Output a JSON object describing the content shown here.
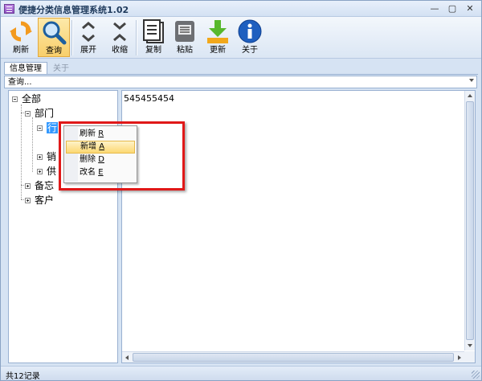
{
  "window": {
    "title": "便捷分类信息管理系统1.02",
    "controls": [
      "—",
      "▢",
      "✕"
    ]
  },
  "toolbar": {
    "refresh_label": "刷新",
    "query_label": "查询",
    "expand_label": "展开",
    "collapse_label": "收缩",
    "copy_label": "复制",
    "paste_label": "粘贴",
    "update_label": "更新",
    "about_label": "关于"
  },
  "tabs": [
    {
      "label": "信息管理",
      "active": true
    },
    {
      "label": "关于",
      "active": false
    }
  ],
  "search": {
    "placeholder": "查询..."
  },
  "tree": {
    "root": "全部",
    "dept": "部门",
    "admin_partial": "行",
    "sales_partial": "销",
    "supply_partial": "供",
    "memo_partial": "备忘",
    "customer": "客户"
  },
  "content": {
    "text": "545455454"
  },
  "context_menu": {
    "items": [
      {
        "label": "刷新",
        "key": "R"
      },
      {
        "label": "新增",
        "key": "A"
      },
      {
        "label": "删除",
        "key": "D"
      },
      {
        "label": "改名",
        "key": "E"
      }
    ]
  },
  "status": {
    "text": "共12记录"
  },
  "colors": {
    "accent": "#3399ff",
    "highlight_box": "#e01818",
    "menu_hover": "#fcd873"
  }
}
